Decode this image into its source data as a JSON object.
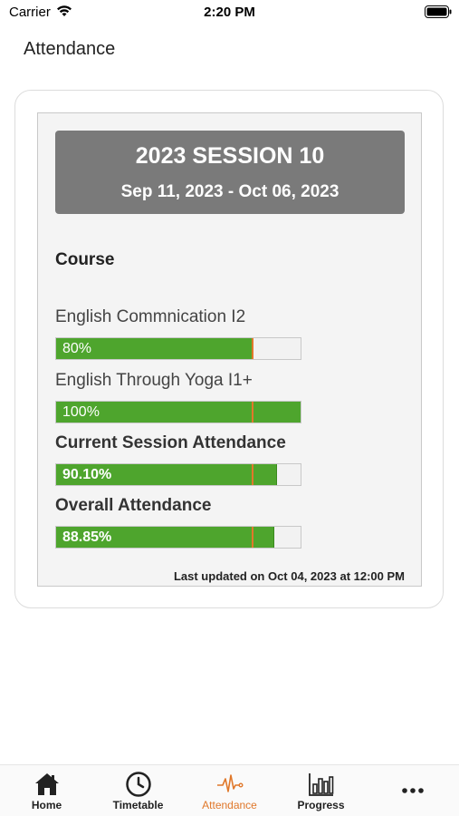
{
  "status_bar": {
    "carrier": "Carrier",
    "time": "2:20 PM"
  },
  "header": {
    "title": "Attendance"
  },
  "session": {
    "name": "2023 SESSION 10",
    "dates": "Sep 11, 2023 - Oct 06, 2023"
  },
  "course_heading": "Course",
  "rows": [
    {
      "label": "English Commnication I2",
      "percent_text": "80%",
      "value": 80
    },
    {
      "label": "English Through Yoga I1+",
      "percent_text": "100%",
      "value": 100
    },
    {
      "label": "Current Session Attendance",
      "percent_text": "90.10%",
      "value": 90.1
    },
    {
      "label": "Overall Attendance",
      "percent_text": "88.85%",
      "value": 88.85
    }
  ],
  "threshold_marker_percent": 80,
  "last_updated": "Last updated on Oct 04, 2023 at 12:00 PM",
  "tabs": [
    {
      "label": "Home",
      "icon": "home-icon"
    },
    {
      "label": "Timetable",
      "icon": "clock-icon"
    },
    {
      "label": "Attendance",
      "icon": "pulse-icon",
      "active": true
    },
    {
      "label": "Progress",
      "icon": "bar-chart-icon"
    },
    {
      "label": "",
      "icon": "more-icon"
    }
  ],
  "colors": {
    "accent": "#e0782a",
    "bar_fill": "#4ea52d",
    "banner": "#7a7a7a"
  }
}
